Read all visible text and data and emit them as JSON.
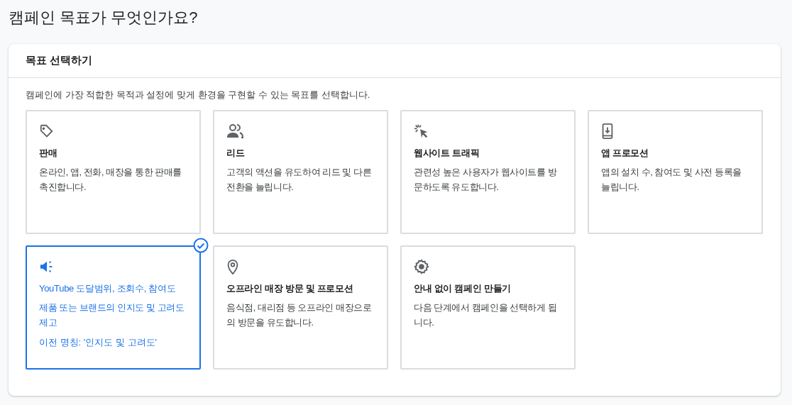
{
  "page_title": "캠페인 목표가 무엇인가요?",
  "panel": {
    "title": "목표 선택하기",
    "description": "캠페인에 가장 적합한 목적과 설정에 맞게 환경을 구현할 수 있는 목표를 선택합니다."
  },
  "goals": [
    {
      "title": "판매",
      "description": "온라인, 앱, 전화, 매장을 통한 판매를 촉진합니다.",
      "selected": false
    },
    {
      "title": "리드",
      "description": "고객의 액션을 유도하여 리드 및 다른 전환을 늘립니다.",
      "selected": false
    },
    {
      "title": "웹사이트 트래픽",
      "description": "관련성 높은 사용자가 웹사이트를 방문하도록 유도합니다.",
      "selected": false
    },
    {
      "title": "앱 프로모션",
      "description": "앱의 설치 수, 참여도 및 사전 등록을 늘립니다.",
      "selected": false
    },
    {
      "title": "YouTube 도달범위, 조회수, 참여도",
      "description": "제품 또는 브랜드의 인지도 및 고려도 제고",
      "note": "이전 명칭: '인지도 및 고려도'",
      "selected": true
    },
    {
      "title": "오프라인 매장 방문 및 프로모션",
      "description": "음식점, 대리점 등 오프라인 매장으로의 방문을 유도합니다.",
      "selected": false
    },
    {
      "title": "안내 없이 캠페인 만들기",
      "description": "다음 단계에서 캠페인을 선택하게 됩니다.",
      "selected": false
    }
  ]
}
